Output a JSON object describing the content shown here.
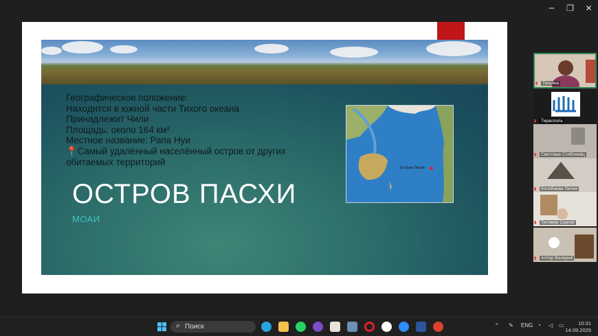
{
  "window_controls": {
    "minimize": "─",
    "restore": "❐",
    "close": "✕"
  },
  "slide": {
    "info_lines": [
      "Географическое положение:",
      "Находится в южной части Тихого океана",
      "Принадлежит Чили",
      "Площадь: около 164 км²",
      "Местное название: Рапа Нуи",
      "Самый удалённый населённый остров от других",
      "обитаемых территорий"
    ],
    "pin_icon": "📍",
    "title": "ОСТРОВ ПАСХИ",
    "subtitle": "МОАИ",
    "map_label": "Остров Пасхи"
  },
  "participants": [
    {
      "name": "Татьяна",
      "active": true
    },
    {
      "name": "Тирасполь"
    },
    {
      "name": "Светлана Стиблиевц"
    },
    {
      "name": "Колобнева Лилия"
    },
    {
      "name": "Титомир Сергей"
    },
    {
      "name": "Алтер Валерий"
    }
  ],
  "taskbar": {
    "search_placeholder": "Поиск",
    "lang": "ENG",
    "time": "10:31",
    "date": "14.09.2025",
    "chevron": "^"
  },
  "colors": {
    "accent_red": "#c0161a",
    "subtitle": "#3fc2c0",
    "slide_bg": "#1d525e"
  }
}
